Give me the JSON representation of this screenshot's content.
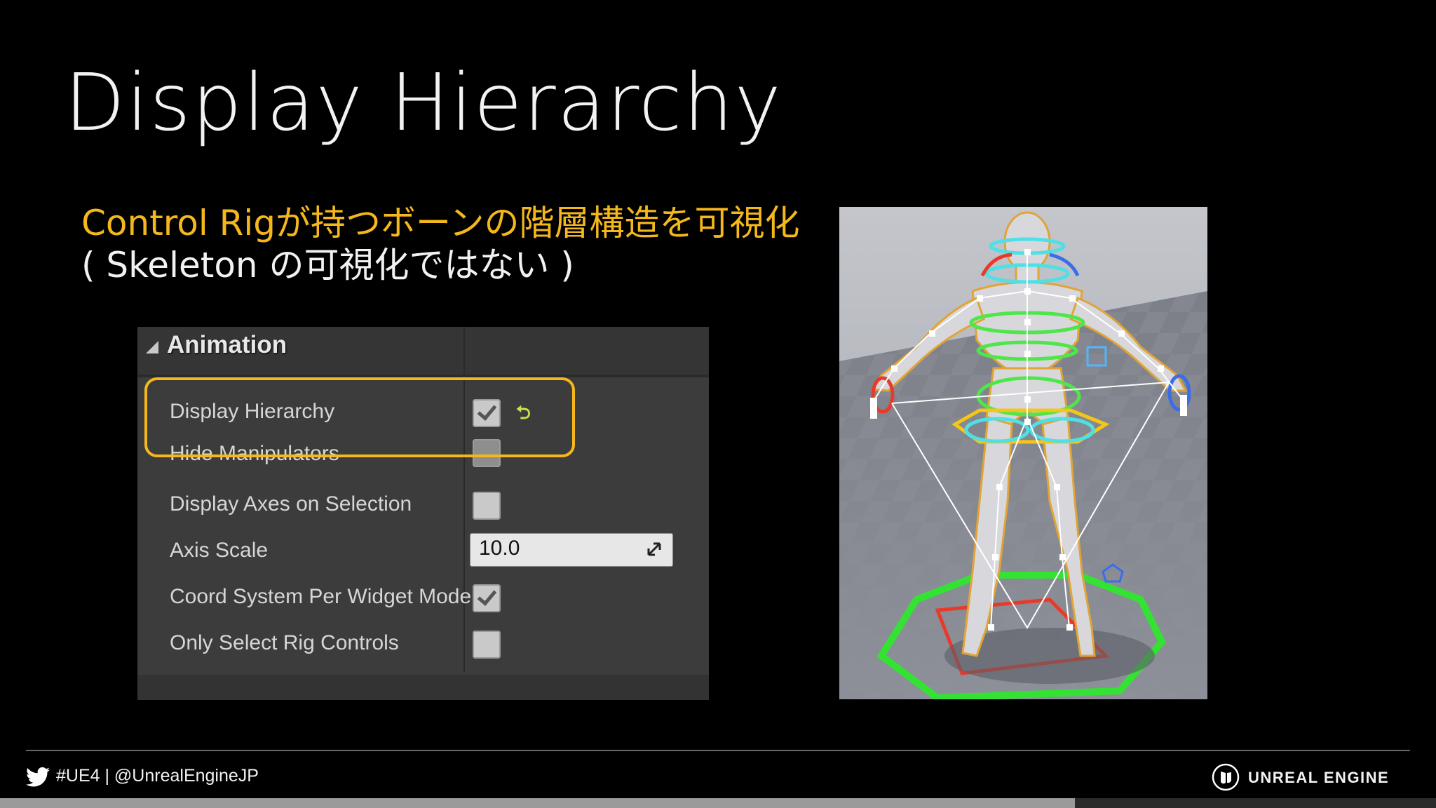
{
  "slide": {
    "title": "Display Hierarchy",
    "subtitle_line1": "Control Rigが持つボーンの階層構造を可視化",
    "subtitle_line2": "( Skeleton の可視化ではない )",
    "colors": {
      "accent": "#f5b81c",
      "background": "#000000"
    }
  },
  "details_panel": {
    "section_label": "Animation",
    "rows": [
      {
        "label": "Display Hierarchy",
        "control": "checkbox",
        "checked": true,
        "reset_icon": "reset-to-default-icon"
      },
      {
        "label": "Hide Manipulators",
        "control": "checkbox",
        "checked": false
      },
      {
        "label": "Display Axes on Selection",
        "control": "checkbox",
        "checked": false
      },
      {
        "label": "Axis Scale",
        "control": "number",
        "value": "10.0"
      },
      {
        "label": "Coord System Per Widget Mode",
        "control": "checkbox",
        "checked": true
      },
      {
        "label": "Only Select Rig Controls",
        "control": "checkbox",
        "checked": false
      }
    ]
  },
  "viewport": {
    "icon": "control-rig-mannequin-viewport"
  },
  "footer": {
    "handle": "#UE4 | @UnrealEngineJP",
    "brand": "UNREAL ENGINE",
    "progress": 0.75
  }
}
